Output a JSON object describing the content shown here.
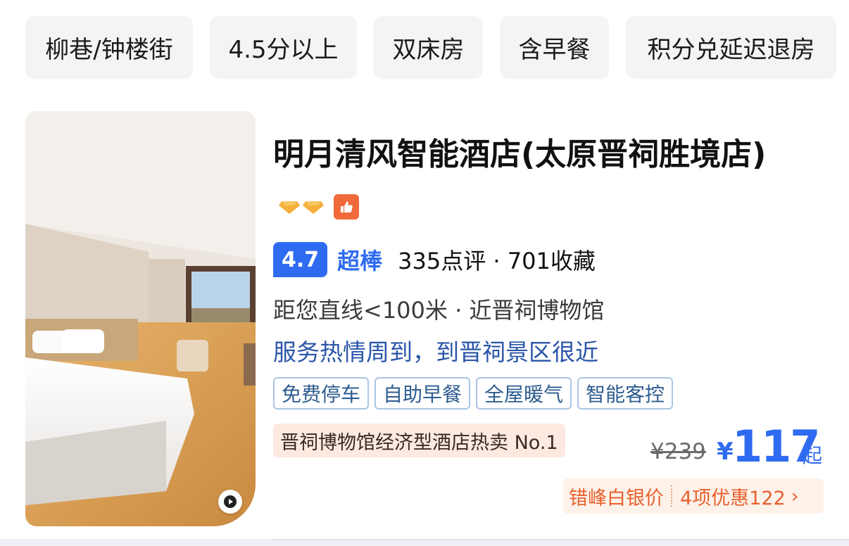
{
  "filters": [
    "柳巷/钟楼街",
    "4.5分以上",
    "双床房",
    "含早餐",
    "积分兑延迟退房"
  ],
  "hotel": {
    "name": "明月清风智能酒店(太原晋祠胜境店)",
    "score": "4.7",
    "score_word": "超棒",
    "reviews": "335点评 · 701收藏",
    "distance": "距您直线<100米 · 近晋祠博物馆",
    "highlight": "服务热情周到，到晋祠景区很近",
    "tags": [
      "免费停车",
      "自助早餐",
      "全屋暖气",
      "智能客控"
    ],
    "rank": "晋祠博物馆经济型酒店热卖 No.1",
    "price": {
      "original": "¥239",
      "currency": "¥",
      "current": "117",
      "suffix": "起"
    },
    "promo": {
      "label": "错峰白银价",
      "offer": "4项优惠122",
      "chevron": "›"
    }
  },
  "colors": {
    "accent": "#2f6bf0",
    "promo": "#e8602c",
    "tag_border": "#a9c6e4"
  }
}
